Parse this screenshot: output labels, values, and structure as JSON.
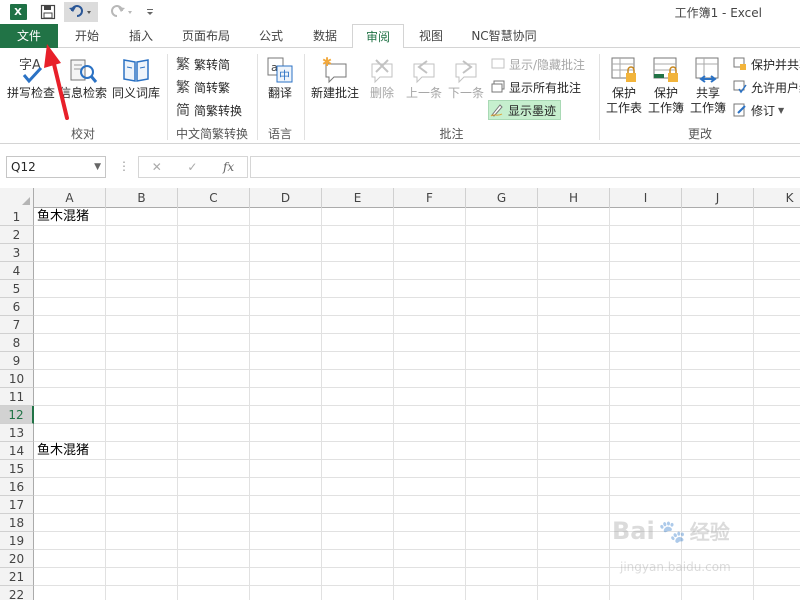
{
  "titlebar": {
    "logo_text": "X",
    "title": "工作簿1 - Excel",
    "undo_icon": "undo-icon",
    "redo_icon": "redo-icon",
    "save_icon": "save-icon",
    "customize_icon": "customize-icon"
  },
  "tabs": [
    {
      "label": "文件"
    },
    {
      "label": "开始"
    },
    {
      "label": "插入"
    },
    {
      "label": "页面布局"
    },
    {
      "label": "公式"
    },
    {
      "label": "数据"
    },
    {
      "label": "审阅"
    },
    {
      "label": "视图"
    },
    {
      "label": "NC智慧协同"
    }
  ],
  "ribbon": {
    "proofing": {
      "label": "校对",
      "spelling": "拼写检查",
      "research": "信息检索",
      "thesaurus": "同义词库",
      "spelling_icon": "spelling-icon"
    },
    "chinese": {
      "label": "中文简繁转换",
      "to_simplified": "繁转简",
      "to_traditional": "简转繁",
      "convert": "简繁转换",
      "to_simplified_icon": "繁",
      "to_traditional_icon": "繁",
      "convert_icon": "简"
    },
    "language": {
      "label": "语言",
      "translate": "翻译"
    },
    "comments": {
      "label": "批注",
      "new": "新建批注",
      "delete": "删除",
      "previous": "上一条",
      "next": "下一条",
      "show_hide": "显示/隐藏批注",
      "show_all": "显示所有批注",
      "show_ink": "显示墨迹"
    },
    "changes": {
      "label": "更改",
      "protect_sheet": [
        "保护",
        "工作表"
      ],
      "protect_workbook": [
        "保护",
        "工作簿"
      ],
      "share_workbook": [
        "共享",
        "工作簿"
      ],
      "protect_share": "保护并共享",
      "allow_users": "允许用户编",
      "track_changes": "修订"
    }
  },
  "formula_bar": {
    "name_box": "Q12",
    "cancel_icon": "✕",
    "enter_icon": "✓",
    "fx_label": "fx",
    "formula": ""
  },
  "grid": {
    "columns": [
      "A",
      "B",
      "C",
      "D",
      "E",
      "F",
      "G",
      "H",
      "I",
      "J",
      "K"
    ],
    "rows": [
      "1",
      "2",
      "3",
      "4",
      "5",
      "6",
      "7",
      "8",
      "9",
      "10",
      "11",
      "12",
      "13",
      "14",
      "15",
      "16",
      "17",
      "18",
      "19",
      "20",
      "21",
      "22"
    ],
    "selected_row": "12",
    "cells": [
      {
        "ref": "A1",
        "row": 1,
        "text": "鱼木混猪"
      },
      {
        "ref": "A14",
        "row": 14,
        "text": "鱼木混猪"
      }
    ]
  },
  "watermark": {
    "brand": "Bai",
    "brand2": "经验",
    "url": "jingyan.baidu.com"
  },
  "colors": {
    "excel_green": "#217346",
    "highlight_green": "#c6efce",
    "annotation_arrow": "#e8202a"
  }
}
